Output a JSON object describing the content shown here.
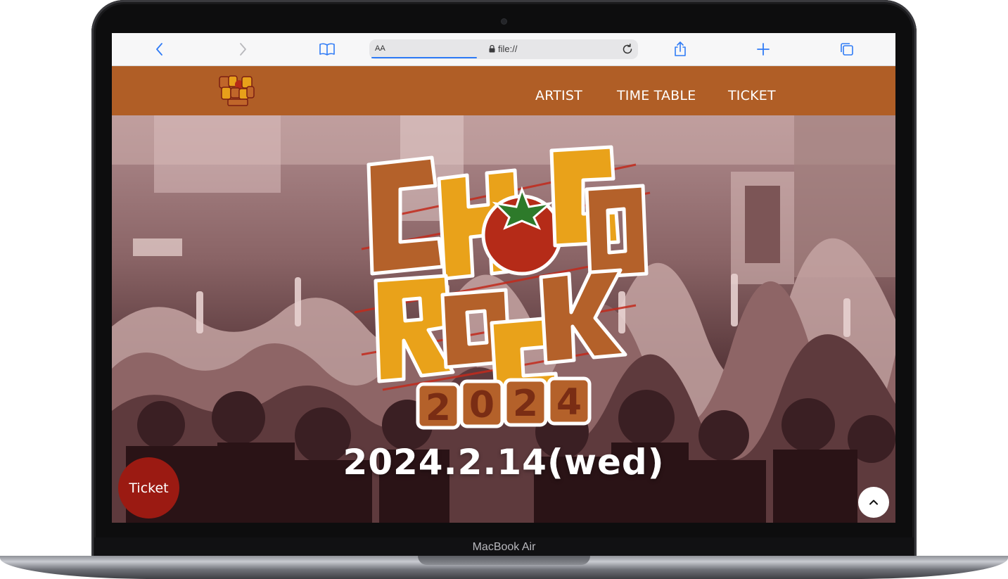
{
  "device": {
    "chin_label": "MacBook Air"
  },
  "browser": {
    "address_bar": {
      "aa_label": "AA",
      "url": "file://"
    },
    "icons": [
      "back-icon",
      "forward-icon",
      "bookmarks-icon",
      "lock-icon",
      "reload-icon",
      "share-icon",
      "new-tab-icon",
      "tabs-icon"
    ],
    "accent_color": "#2f7bf6"
  },
  "site": {
    "header_color": "#b05e26",
    "nav": {
      "artist": "ARTIST",
      "timetable": "TIME TABLE",
      "ticket": "TICKET"
    },
    "hero": {
      "logo": {
        "line1": "CHOCO",
        "line2": "ROCK",
        "line3": "2024"
      },
      "date": "2024.2.14(wed)",
      "ticket_button": "Ticket",
      "ticket_button_color": "#9b1a12"
    }
  }
}
